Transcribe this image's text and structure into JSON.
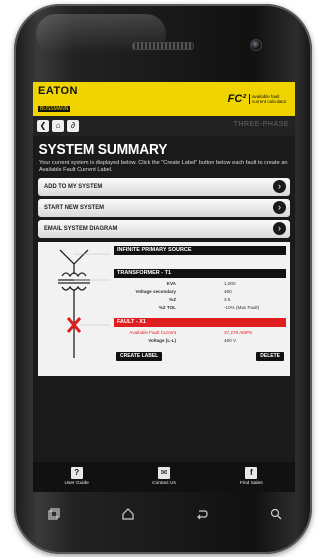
{
  "header": {
    "brand": "EATON",
    "brand_sub": "BUSSMANN",
    "brand_series": "SERIES",
    "app_short": "FC²",
    "app_tagline": "available fault current calculator"
  },
  "nav": {
    "mode": "THREE-PHASE"
  },
  "summary": {
    "title": "SYSTEM SUMMARY",
    "description": "Your current system is displayed below. Click the \"Create Label\" button below each fault to create an Available Fault Current Label."
  },
  "menu": [
    {
      "label": "ADD TO MY SYSTEM"
    },
    {
      "label": "START NEW SYSTEM"
    },
    {
      "label": "EMAIL SYSTEM DIAGRAM"
    }
  ],
  "diagram": {
    "source_label": "INFINITE PRIMARY SOURCE",
    "transformer_label": "TRANSFORMER - T1",
    "transformer_rows": [
      {
        "key": "KVA",
        "value": "1,000"
      },
      {
        "key": "Voltage secondary",
        "value": "480"
      },
      {
        "key": "%Z",
        "value": "3.5"
      },
      {
        "key": "%Z TOL",
        "value": "-10% (Max Fault)"
      }
    ],
    "fault_label": "FAULT - X1",
    "fault_rows": [
      {
        "key": "Available Fault Current",
        "value": "37,276 AMPS"
      },
      {
        "key": "Voltage (L-L)",
        "value": "480 V"
      }
    ],
    "create_label": "CREATE LABEL",
    "delete_label": "DELETE"
  },
  "tabs": [
    {
      "label": "User Guide",
      "icon": "?"
    },
    {
      "label": "Contact Us",
      "icon": "✉"
    },
    {
      "label": "Find Sales",
      "icon": "f"
    }
  ],
  "colors": {
    "accent": "#f0d400",
    "fault": "#e02020",
    "screen_bg": "#1a1a1a"
  }
}
